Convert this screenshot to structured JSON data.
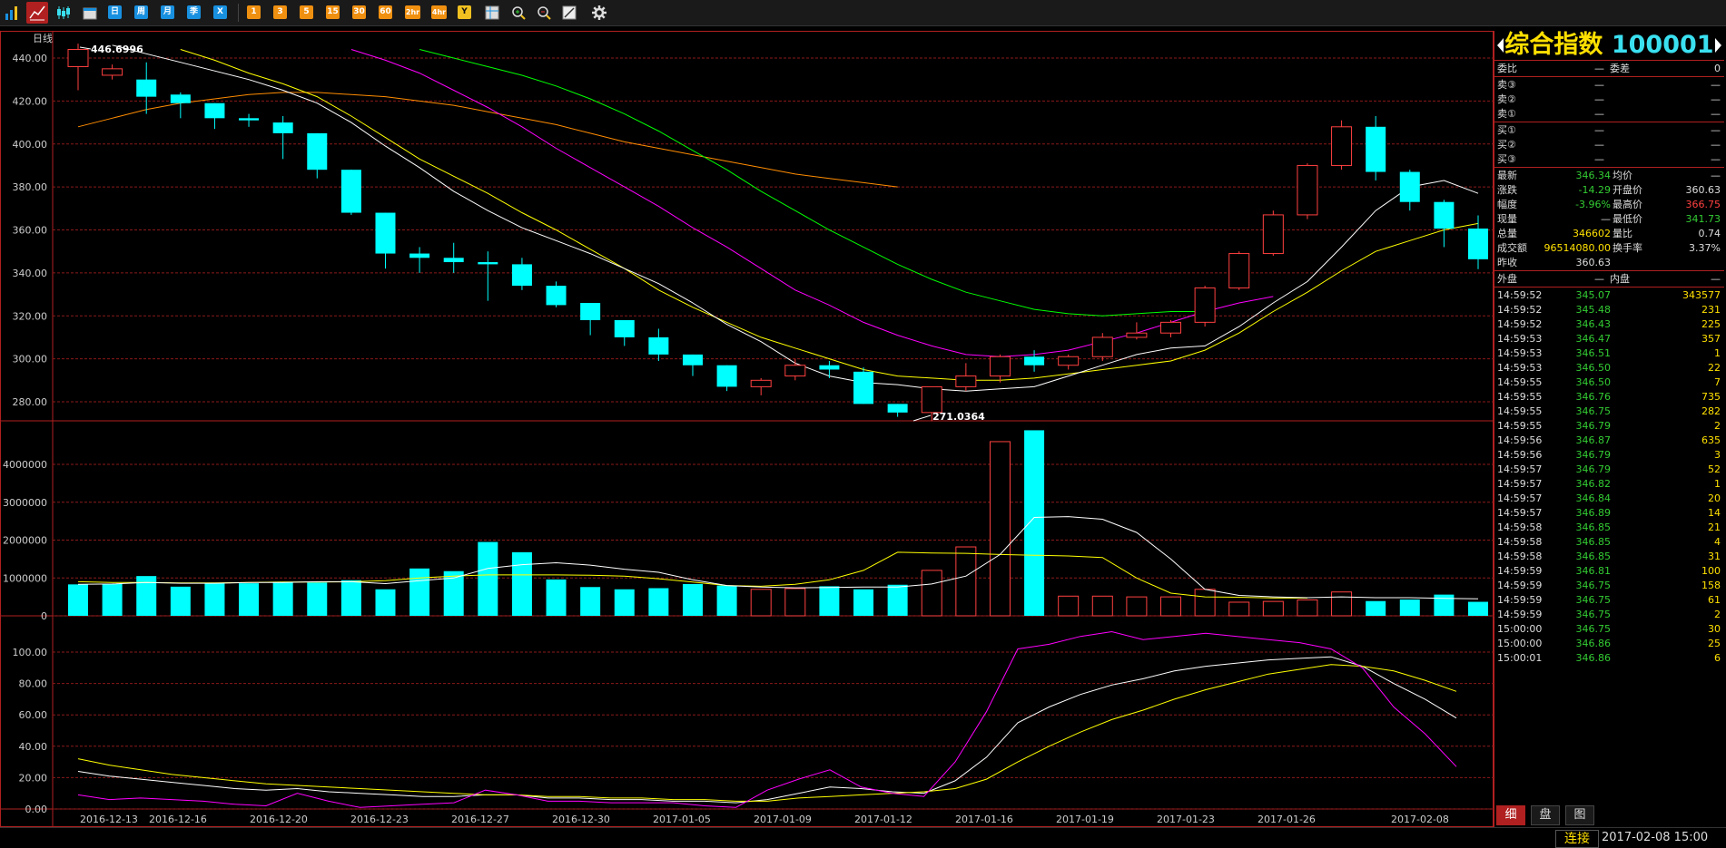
{
  "toolbar": {
    "buttons": [
      "日",
      "周",
      "月",
      "季",
      "X",
      "1",
      "3",
      "5",
      "15",
      "30",
      "60",
      "2hr",
      "4hr",
      "Y"
    ]
  },
  "chart": {
    "period_label": "日线",
    "high_marker": "446.6996",
    "low_marker": "271.0364",
    "price_ticks": [
      "440.00",
      "420.00",
      "400.00",
      "380.00",
      "360.00",
      "340.00",
      "320.00",
      "300.00",
      "280.00"
    ],
    "volume_ticks": [
      "4000000",
      "3000000",
      "2000000",
      "1000000",
      "0"
    ],
    "indicator_ticks": [
      "100.00",
      "80.00",
      "60.00",
      "40.00",
      "20.00",
      "0.00"
    ],
    "date_labels": [
      "2016-12-13",
      "2016-12-16",
      "2016-12-20",
      "2016-12-23",
      "2016-12-27",
      "2016-12-30",
      "2017-01-05",
      "2017-01-09",
      "2017-01-12",
      "2017-01-16",
      "2017-01-19",
      "2017-01-23",
      "2017-01-26",
      "2017-02-08"
    ],
    "colors": {
      "up": "#ff4040",
      "down": "#00ffff",
      "ma5": "#ffffff",
      "ma10": "#ffff00",
      "ma20": "#ff00ff",
      "ma30": "#00ff00",
      "ma60": "#ff8c00",
      "grid": "#8b1a1a"
    }
  },
  "chart_data": [
    {
      "type": "candlestick",
      "title": "日线",
      "ylim": [
        271,
        447
      ],
      "candles": [
        {
          "o": 436,
          "h": 446.7,
          "l": 425,
          "c": 444
        },
        {
          "o": 432,
          "h": 437,
          "l": 430,
          "c": 435
        },
        {
          "o": 430,
          "h": 438,
          "l": 414,
          "c": 422
        },
        {
          "o": 423,
          "h": 424,
          "l": 412,
          "c": 419
        },
        {
          "o": 419,
          "h": 419,
          "l": 407,
          "c": 412
        },
        {
          "o": 412,
          "h": 414,
          "l": 408,
          "c": 411
        },
        {
          "o": 410,
          "h": 413,
          "l": 393,
          "c": 405
        },
        {
          "o": 405,
          "h": 405,
          "l": 384,
          "c": 388
        },
        {
          "o": 388,
          "h": 388,
          "l": 367,
          "c": 368
        },
        {
          "o": 368,
          "h": 368,
          "l": 342,
          "c": 349
        },
        {
          "o": 349,
          "h": 352,
          "l": 340,
          "c": 347
        },
        {
          "o": 347,
          "h": 354,
          "l": 340,
          "c": 345
        },
        {
          "o": 345,
          "h": 350,
          "l": 327,
          "c": 344
        },
        {
          "o": 344,
          "h": 347,
          "l": 332,
          "c": 334
        },
        {
          "o": 334,
          "h": 336,
          "l": 324,
          "c": 325
        },
        {
          "o": 326,
          "h": 326,
          "l": 311,
          "c": 318
        },
        {
          "o": 318,
          "h": 318,
          "l": 306,
          "c": 310
        },
        {
          "o": 310,
          "h": 314,
          "l": 299,
          "c": 302
        },
        {
          "o": 302,
          "h": 302,
          "l": 292,
          "c": 297
        },
        {
          "o": 297,
          "h": 297,
          "l": 285,
          "c": 287
        },
        {
          "o": 287,
          "h": 291,
          "l": 283,
          "c": 290
        },
        {
          "o": 292,
          "h": 300,
          "l": 290,
          "c": 297
        },
        {
          "o": 297,
          "h": 299,
          "l": 291,
          "c": 295
        },
        {
          "o": 294,
          "h": 296,
          "l": 279,
          "c": 279
        },
        {
          "o": 279,
          "h": 279,
          "l": 273,
          "c": 275
        },
        {
          "o": 275,
          "h": 284,
          "l": 271,
          "c": 287
        },
        {
          "o": 287,
          "h": 298,
          "l": 285,
          "c": 292
        },
        {
          "o": 292,
          "h": 302,
          "l": 289,
          "c": 301
        },
        {
          "o": 301,
          "h": 304,
          "l": 294,
          "c": 297
        },
        {
          "o": 297,
          "h": 302,
          "l": 295,
          "c": 301
        },
        {
          "o": 301,
          "h": 312,
          "l": 299,
          "c": 310
        },
        {
          "o": 310,
          "h": 317,
          "l": 309,
          "c": 312
        },
        {
          "o": 312,
          "h": 318,
          "l": 310,
          "c": 317
        },
        {
          "o": 317,
          "h": 334,
          "l": 315,
          "c": 333
        },
        {
          "o": 333,
          "h": 350,
          "l": 332,
          "c": 349
        },
        {
          "o": 349,
          "h": 369,
          "l": 348,
          "c": 367
        },
        {
          "o": 367,
          "h": 391,
          "l": 365,
          "c": 390
        },
        {
          "o": 390,
          "h": 411,
          "l": 388,
          "c": 408
        },
        {
          "o": 408,
          "h": 413,
          "l": 383,
          "c": 387
        },
        {
          "o": 387,
          "h": 388,
          "l": 369,
          "c": 373
        },
        {
          "o": 373,
          "h": 374,
          "l": 352,
          "c": 360.6
        },
        {
          "o": 360.63,
          "h": 366.75,
          "l": 341.73,
          "c": 346.34
        }
      ],
      "ma5": [
        446,
        442,
        438,
        434,
        430,
        425,
        419,
        410,
        399,
        389,
        378,
        369,
        361,
        355,
        349,
        342,
        335,
        326,
        316,
        308,
        298,
        292,
        289,
        288,
        286,
        285,
        286,
        287,
        292,
        297,
        302,
        305,
        306,
        315,
        326,
        336,
        352,
        369,
        380,
        383,
        377
      ],
      "ma10": [
        444,
        439,
        433,
        428,
        422,
        413,
        403,
        393,
        385,
        377,
        368,
        360,
        351,
        342,
        332,
        324,
        317,
        310,
        305,
        300,
        295,
        292,
        291,
        290,
        290,
        291,
        293,
        295,
        297,
        299,
        304,
        312,
        322,
        331,
        341,
        350,
        355,
        360,
        363
      ],
      "ma20": [
        444,
        439,
        433,
        425,
        417,
        408,
        398,
        389,
        380,
        371,
        361,
        352,
        342,
        332,
        325,
        317,
        311,
        306,
        302,
        301,
        302,
        304,
        308,
        312,
        317,
        322,
        326,
        329
      ],
      "ma30": [
        444,
        440,
        436,
        432,
        427,
        421,
        414,
        406,
        397,
        388,
        378,
        369,
        360,
        352,
        344,
        337,
        331,
        327,
        323,
        321,
        320,
        321,
        322,
        322
      ],
      "ma60": [
        408,
        412,
        416,
        419,
        421,
        423,
        424,
        424,
        423,
        422,
        420,
        418,
        415,
        412,
        409,
        405,
        401,
        398,
        395,
        392,
        389,
        386,
        384,
        382,
        380
      ]
    },
    {
      "type": "bar",
      "title": "VOL",
      "ylim": [
        0,
        4800000
      ],
      "values": [
        830000,
        850000,
        1050000,
        770000,
        860000,
        860000,
        900000,
        880000,
        940000,
        700000,
        1250000,
        1180000,
        1950000,
        1680000,
        960000,
        760000,
        700000,
        730000,
        840000,
        800000,
        700000,
        720000,
        780000,
        700000,
        820000,
        1200000,
        1820000,
        4600000,
        4900000,
        520000,
        520000,
        500000,
        500000,
        700000,
        360000,
        380000,
        420000,
        630000,
        390000,
        430000,
        560000,
        370000
      ],
      "up": [
        false,
        false,
        false,
        false,
        false,
        false,
        false,
        false,
        false,
        false,
        false,
        false,
        false,
        false,
        false,
        false,
        false,
        false,
        false,
        false,
        true,
        true,
        false,
        false,
        false,
        true,
        true,
        true,
        false,
        true,
        true,
        true,
        true,
        true,
        true,
        true,
        true,
        true,
        false,
        false,
        false,
        false
      ],
      "ma5": [
        830000,
        840000,
        880000,
        860000,
        860000,
        880000,
        880000,
        900000,
        900000,
        850000,
        930000,
        1000000,
        1250000,
        1350000,
        1400000,
        1340000,
        1230000,
        1150000,
        950000,
        800000,
        760000,
        740000,
        750000,
        760000,
        760000,
        840000,
        1050000,
        1620000,
        2600000,
        2620000,
        2550000,
        2200000,
        1500000,
        700000,
        540000,
        500000,
        480000,
        500000,
        480000,
        480000,
        460000,
        450000
      ],
      "ma10": [
        900000,
        880000,
        880000,
        870000,
        870000,
        880000,
        890000,
        890000,
        900000,
        930000,
        1000000,
        1050000,
        1080000,
        1080000,
        1080000,
        1070000,
        1050000,
        980000,
        890000,
        800000,
        780000,
        830000,
        950000,
        1200000,
        1680000,
        1660000,
        1650000,
        1620000,
        1600000,
        1580000,
        1540000,
        1000000,
        600000,
        500000,
        490000,
        470000,
        470000
      ]
    },
    {
      "type": "line",
      "title": "KDJ",
      "ylim": [
        0,
        110
      ],
      "series": [
        {
          "name": "K",
          "values": [
            24,
            21,
            19,
            17,
            15,
            13,
            12,
            13,
            11,
            10,
            9,
            8,
            8,
            9,
            9,
            7,
            7,
            6,
            6,
            5,
            5,
            4,
            6,
            10,
            14,
            13,
            11,
            10,
            18,
            33,
            55,
            65,
            73,
            79,
            83,
            88,
            91,
            93,
            95,
            96,
            97,
            91,
            80,
            70,
            58
          ]
        },
        {
          "name": "D",
          "values": [
            32,
            28,
            25,
            22,
            20,
            18,
            16,
            15,
            14,
            13,
            12,
            11,
            10,
            9,
            9,
            8,
            8,
            7,
            7,
            6,
            6,
            5,
            5,
            7,
            8,
            9,
            10,
            11,
            13,
            19,
            30,
            40,
            49,
            57,
            63,
            70,
            76,
            81,
            86,
            89,
            92,
            91,
            88,
            82,
            75
          ]
        },
        {
          "name": "J",
          "values": [
            9,
            6,
            7,
            6,
            5,
            3,
            2,
            10,
            5,
            1,
            2,
            3,
            4,
            12,
            9,
            5,
            5,
            4,
            4,
            4,
            2,
            1,
            12,
            19,
            25,
            14,
            10,
            8,
            30,
            62,
            102,
            105,
            110,
            113,
            108,
            110,
            112,
            110,
            108,
            106,
            102,
            90,
            65,
            48,
            27
          ]
        }
      ]
    }
  ],
  "panel": {
    "name": "综合指数",
    "code": "100001",
    "quote_rows": [
      {
        "label": "委比",
        "value": "—",
        "label2": "委差",
        "value2": "0"
      }
    ],
    "sell_rows": [
      {
        "label": "卖③",
        "price": "—",
        "vol": "—"
      },
      {
        "label": "卖②",
        "price": "—",
        "vol": "—"
      },
      {
        "label": "卖①",
        "price": "—",
        "vol": "—"
      }
    ],
    "buy_rows": [
      {
        "label": "买①",
        "price": "—",
        "vol": "—"
      },
      {
        "label": "买②",
        "price": "—",
        "vol": "—"
      },
      {
        "label": "买③",
        "price": "—",
        "vol": "—"
      }
    ],
    "stats": [
      {
        "l1": "最新",
        "v1": "346.34",
        "l2": "均价",
        "v2": "—"
      },
      {
        "l1": "涨跌",
        "v1": "-14.29",
        "l2": "开盘价",
        "v2": "360.63"
      },
      {
        "l1": "幅度",
        "v1": "-3.96%",
        "l2": "最高价",
        "v2": "366.75"
      },
      {
        "l1": "现量",
        "v1": "—",
        "l2": "最低价",
        "v2": "341.73"
      },
      {
        "l1": "总量",
        "v1": "346602",
        "l2": "量比",
        "v2": "0.74"
      },
      {
        "l1": "成交额",
        "v1": "96514080.00",
        "l2": "换手率",
        "v2": "3.37%"
      },
      {
        "l1": "昨收",
        "v1": "360.63",
        "l2": "",
        "v2": ""
      }
    ],
    "outer_label": "外盘",
    "outer_value": "—",
    "inner_label": "内盘",
    "inner_value": "—",
    "ticks": [
      {
        "t": "14:59:52",
        "p": "345.07",
        "v": "343577"
      },
      {
        "t": "14:59:52",
        "p": "345.48",
        "v": "231"
      },
      {
        "t": "14:59:52",
        "p": "346.43",
        "v": "225"
      },
      {
        "t": "14:59:53",
        "p": "346.47",
        "v": "357"
      },
      {
        "t": "14:59:53",
        "p": "346.51",
        "v": "1"
      },
      {
        "t": "14:59:53",
        "p": "346.50",
        "v": "22"
      },
      {
        "t": "14:59:55",
        "p": "346.50",
        "v": "7"
      },
      {
        "t": "14:59:55",
        "p": "346.76",
        "v": "735"
      },
      {
        "t": "14:59:55",
        "p": "346.75",
        "v": "282"
      },
      {
        "t": "14:59:55",
        "p": "346.79",
        "v": "2"
      },
      {
        "t": "14:59:56",
        "p": "346.87",
        "v": "635"
      },
      {
        "t": "14:59:56",
        "p": "346.79",
        "v": "3"
      },
      {
        "t": "14:59:57",
        "p": "346.79",
        "v": "52"
      },
      {
        "t": "14:59:57",
        "p": "346.82",
        "v": "1"
      },
      {
        "t": "14:59:57",
        "p": "346.84",
        "v": "20"
      },
      {
        "t": "14:59:57",
        "p": "346.89",
        "v": "14"
      },
      {
        "t": "14:59:58",
        "p": "346.85",
        "v": "21"
      },
      {
        "t": "14:59:58",
        "p": "346.85",
        "v": "4"
      },
      {
        "t": "14:59:58",
        "p": "346.85",
        "v": "31"
      },
      {
        "t": "14:59:59",
        "p": "346.81",
        "v": "100"
      },
      {
        "t": "14:59:59",
        "p": "346.75",
        "v": "158"
      },
      {
        "t": "14:59:59",
        "p": "346.75",
        "v": "61"
      },
      {
        "t": "14:59:59",
        "p": "346.75",
        "v": "2"
      },
      {
        "t": "15:00:00",
        "p": "346.75",
        "v": "30"
      },
      {
        "t": "15:00:00",
        "p": "346.86",
        "v": "25"
      },
      {
        "t": "15:00:01",
        "p": "346.86",
        "v": "6"
      }
    ],
    "tabs": [
      "细",
      "盘",
      "图"
    ]
  },
  "status": {
    "connection": "连接",
    "datetime": "2017-02-08 15:00"
  }
}
